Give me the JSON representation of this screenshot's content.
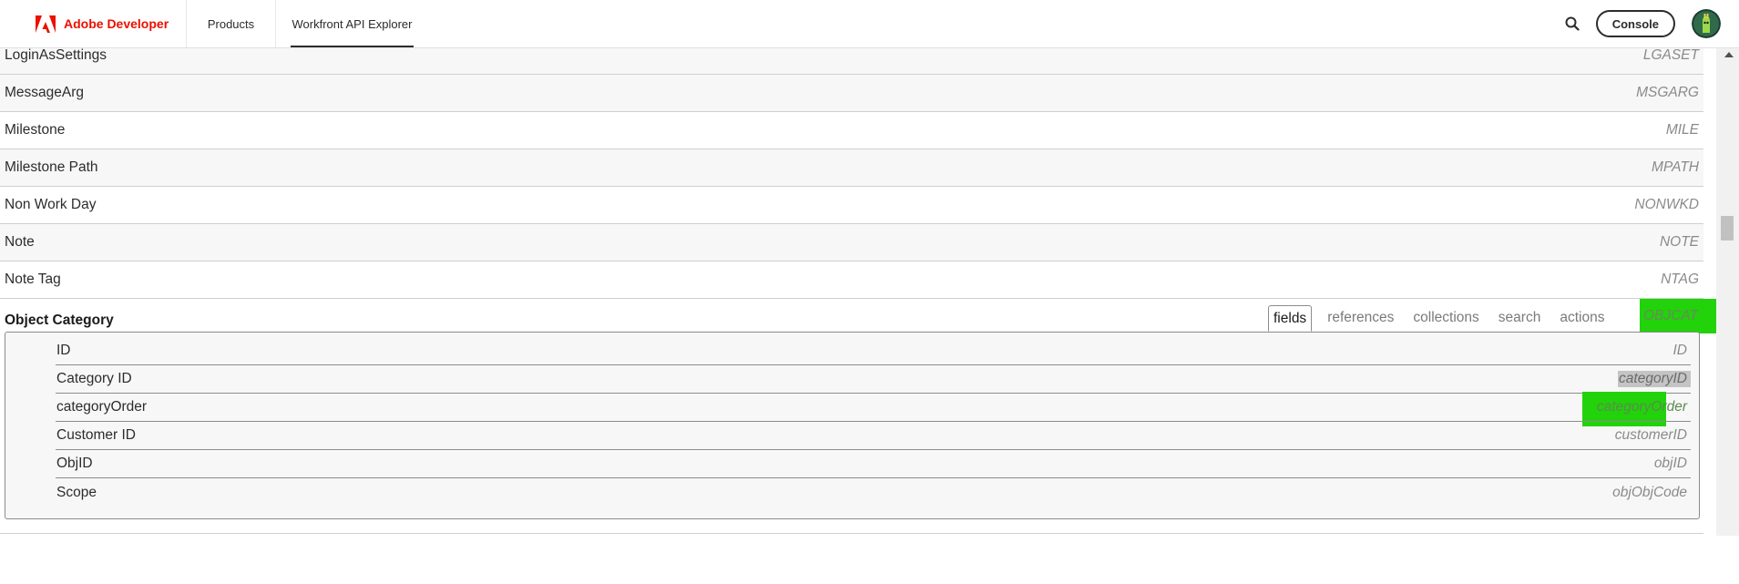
{
  "header": {
    "brand_name": "Adobe Developer",
    "nav": {
      "products": "Products",
      "explorer": "Workfront API Explorer"
    },
    "console_label": "Console"
  },
  "objects": [
    {
      "name": "LoginAsSettings",
      "code": "LGASET"
    },
    {
      "name": "MessageArg",
      "code": "MSGARG"
    },
    {
      "name": "Milestone",
      "code": "MILE"
    },
    {
      "name": "Milestone Path",
      "code": "MPATH"
    },
    {
      "name": "Non Work Day",
      "code": "NONWKD"
    },
    {
      "name": "Note",
      "code": "NOTE"
    },
    {
      "name": "Note Tag",
      "code": "NTAG"
    }
  ],
  "expanded": {
    "title": "Object Category",
    "code": "OBJCAT",
    "tabs": [
      "fields",
      "references",
      "collections",
      "search",
      "actions"
    ],
    "active_tab": "fields",
    "fields": [
      {
        "name": "ID",
        "code": "ID"
      },
      {
        "name": "Category ID",
        "code": "categoryID"
      },
      {
        "name": "categoryOrder",
        "code": "categoryOrder"
      },
      {
        "name": "Customer ID",
        "code": "customerID"
      },
      {
        "name": "ObjID",
        "code": "objID"
      },
      {
        "name": "Scope",
        "code": "objObjCode"
      }
    ]
  },
  "colors": {
    "brand_red": "#eb1000",
    "highlight_green": "#22d20b",
    "selection_gray": "#c4c4c4"
  },
  "icons": {
    "search": "search-icon",
    "logo": "adobe-logo-icon",
    "avatar": "avatar",
    "scroll_up": "scroll-up-arrow-icon"
  }
}
